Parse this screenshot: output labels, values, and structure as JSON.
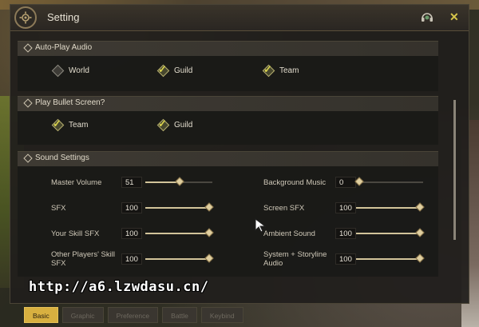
{
  "window": {
    "title": "Setting",
    "emblem_icon": "gear-icon",
    "support_icon": "headset-icon",
    "close_icon": "close-icon",
    "close_glyph": "✕"
  },
  "sections": {
    "autoplay": {
      "label": "Auto-Play Audio",
      "options": [
        {
          "label": "World",
          "checked": false
        },
        {
          "label": "Guild",
          "checked": true
        },
        {
          "label": "Team",
          "checked": true
        }
      ]
    },
    "bullet": {
      "label": "Play Bullet Screen?",
      "options": [
        {
          "label": "Team",
          "checked": true
        },
        {
          "label": "Guild",
          "checked": true
        }
      ]
    },
    "sound": {
      "label": "Sound Settings",
      "sliders": [
        {
          "label": "Master Volume",
          "value": "51"
        },
        {
          "label": "Background Music",
          "value": "0"
        },
        {
          "label": "SFX",
          "value": "100"
        },
        {
          "label": "Screen SFX",
          "value": "100"
        },
        {
          "label": "Your Skill SFX",
          "value": "100"
        },
        {
          "label": "Ambient Sound",
          "value": "100"
        },
        {
          "label": "Other Players' Skill SFX",
          "value": "100"
        },
        {
          "label": "System + Storyline Audio",
          "value": "100"
        }
      ]
    }
  },
  "tabs": [
    {
      "label": "Basic",
      "active": true
    },
    {
      "label": "Graphic",
      "active": false
    },
    {
      "label": "Preference",
      "active": false
    },
    {
      "label": "Battle",
      "active": false
    },
    {
      "label": "Keybind",
      "active": false
    }
  ],
  "watermark": "http://a6.lzwdasu.cn/",
  "colors": {
    "accent": "#d8b040",
    "check": "#d9d24d",
    "close": "#d7c64a"
  }
}
